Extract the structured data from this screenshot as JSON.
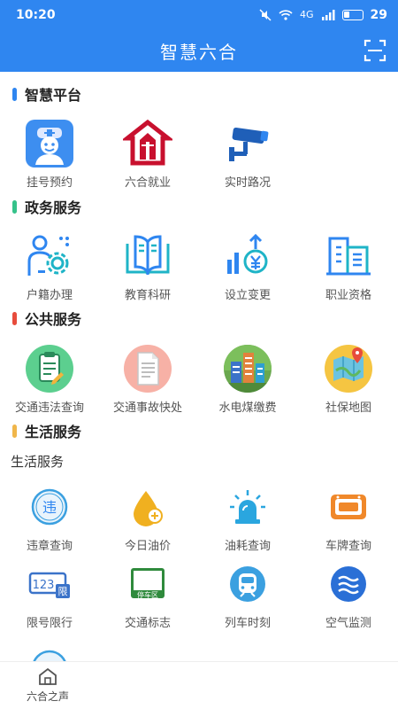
{
  "status_bar": {
    "time": "10:20",
    "network": "4G",
    "battery": "29"
  },
  "header": {
    "title": "智慧六合",
    "scan_icon": "scan-icon"
  },
  "sections": [
    {
      "title": "智慧平台",
      "color": "#2f86f0",
      "items": [
        {
          "label": "挂号预约",
          "icon": "doctor-icon"
        },
        {
          "label": "六合就业",
          "icon": "house-logo-icon"
        },
        {
          "label": "实时路况",
          "icon": "camera-icon"
        }
      ]
    },
    {
      "title": "政务服务",
      "color": "#35c28a",
      "items": [
        {
          "label": "户籍办理",
          "icon": "person-gear-icon"
        },
        {
          "label": "教育科研",
          "icon": "book-icon"
        },
        {
          "label": "设立变更",
          "icon": "yuan-growth-icon"
        },
        {
          "label": "职业资格",
          "icon": "building-icon"
        }
      ]
    },
    {
      "title": "公共服务",
      "color": "#e74c3c",
      "items": [
        {
          "label": "交通违法查询",
          "icon": "clipboard-icon"
        },
        {
          "label": "交通事故快处",
          "icon": "document-icon"
        },
        {
          "label": "水电煤缴费",
          "icon": "city-icon"
        },
        {
          "label": "社保地图",
          "icon": "map-icon"
        }
      ]
    },
    {
      "title": "生活服务",
      "color": "#f0b64a",
      "sub_label": "生活服务",
      "items": [
        {
          "label": "违章查询",
          "icon": "violation-icon"
        },
        {
          "label": "今日油价",
          "icon": "oil-drop-icon"
        },
        {
          "label": "油耗查询",
          "icon": "siren-icon"
        },
        {
          "label": "车牌查询",
          "icon": "license-plate-icon"
        },
        {
          "label": "限号限行",
          "icon": "plate-limit-icon"
        },
        {
          "label": "交通标志",
          "icon": "parking-sign-icon"
        },
        {
          "label": "列车时刻",
          "icon": "train-icon"
        },
        {
          "label": "空气监测",
          "icon": "air-icon"
        }
      ]
    }
  ],
  "bottom_nav": [
    {
      "label": "六合之声",
      "icon": "home-icon"
    }
  ]
}
